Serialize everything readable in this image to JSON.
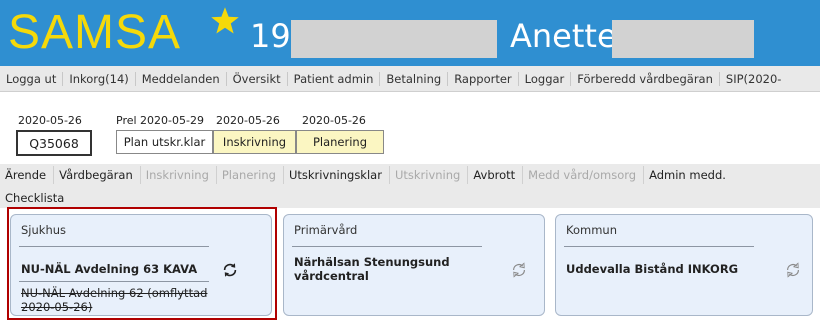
{
  "header": {
    "app_title": "SAMSA",
    "star_icon": "star-icon",
    "patient_number": "19",
    "user_name": "Anette",
    "colors": {
      "background": "#2f8fd1",
      "logo": "#f5d90a"
    }
  },
  "menu": [
    "Logga ut",
    "Inkorg(14)",
    "Meddelanden",
    "Översikt",
    "Patient admin",
    "Betalning",
    "Rapporter",
    "Loggar",
    "Förberedd vårdbegäran",
    "SIP(2020-"
  ],
  "case": {
    "date": "2020-05-26",
    "number": "Q35068",
    "stages": [
      {
        "date": "Prel 2020-05-29",
        "label": "Plan utskr.klar",
        "highlighted": false
      },
      {
        "date": "2020-05-26",
        "label": "Inskrivning",
        "highlighted": true
      },
      {
        "date": "2020-05-26",
        "label": "Planering",
        "highlighted": true
      }
    ]
  },
  "actions": [
    {
      "label": "Ärende",
      "enabled": true
    },
    {
      "label": "Vårdbegäran",
      "enabled": true
    },
    {
      "label": "Inskrivning",
      "enabled": false
    },
    {
      "label": "Planering",
      "enabled": false
    },
    {
      "label": "Utskrivningsklar",
      "enabled": true
    },
    {
      "label": "Utskrivning",
      "enabled": false
    },
    {
      "label": "Avbrott",
      "enabled": true
    },
    {
      "label": "Medd vård/omsorg",
      "enabled": false
    },
    {
      "label": "Admin medd.",
      "enabled": true
    }
  ],
  "checklist_label": "Checklista",
  "cards": {
    "sjukhus": {
      "title": "Sjukhus",
      "unit": "NU-NÄL Avdelning 63 KAVA",
      "previous_unit": "NU-NÄL Avdelning 62 (omflyttad 2020-05-26)",
      "icon": "sync-icon"
    },
    "primarvard": {
      "title": "Primärvård",
      "unit": "Närhälsan Stenungsund vårdcentral",
      "icon": "sync-icon"
    },
    "kommun": {
      "title": "Kommun",
      "unit": "Uddevalla Bistånd INKORG",
      "icon": "sync-icon"
    }
  }
}
